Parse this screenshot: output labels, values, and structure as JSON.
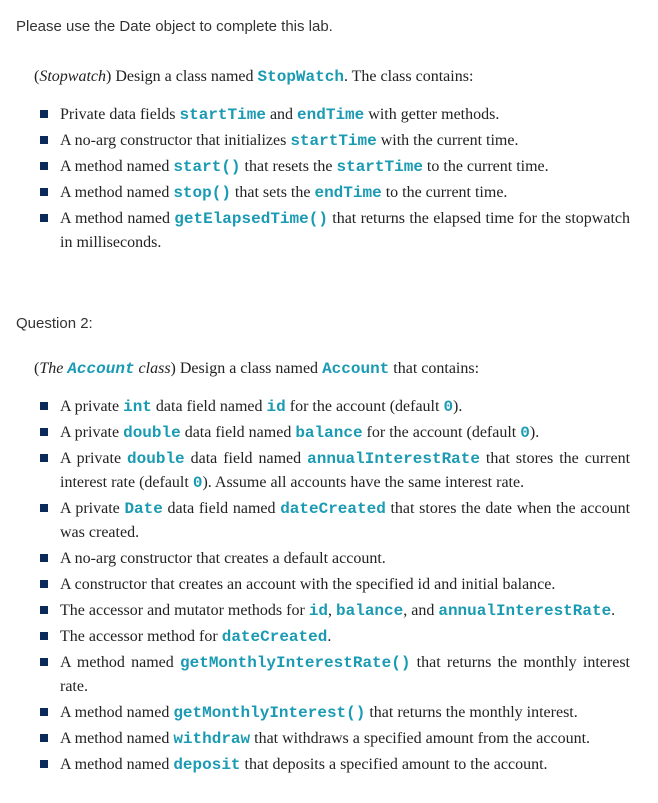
{
  "intro": "Please use the Date object to complete this lab.",
  "q1": {
    "prompt_pre_italic": "(",
    "prompt_italic": "Stopwatch",
    "prompt_post": ") Design a class named ",
    "prompt_code": "StopWatch",
    "prompt_tail": ". The class contains:",
    "items": [
      {
        "segments": [
          {
            "t": "Private data fields "
          },
          {
            "t": "startTime",
            "code": true
          },
          {
            "t": " and "
          },
          {
            "t": "endTime",
            "code": true
          },
          {
            "t": " with getter methods."
          }
        ]
      },
      {
        "segments": [
          {
            "t": "A no-arg constructor that initializes "
          },
          {
            "t": "startTime",
            "code": true
          },
          {
            "t": " with the current time."
          }
        ]
      },
      {
        "segments": [
          {
            "t": "A method named "
          },
          {
            "t": "start()",
            "code": true
          },
          {
            "t": " that resets the "
          },
          {
            "t": "startTime",
            "code": true
          },
          {
            "t": " to the current time."
          }
        ]
      },
      {
        "segments": [
          {
            "t": "A method named "
          },
          {
            "t": "stop()",
            "code": true
          },
          {
            "t": " that sets the "
          },
          {
            "t": "endTime",
            "code": true
          },
          {
            "t": " to the current time."
          }
        ]
      },
      {
        "segments": [
          {
            "t": "A method named "
          },
          {
            "t": "getElapsedTime()",
            "code": true
          },
          {
            "t": " that returns the elapsed time for the stopwatch in milliseconds."
          }
        ]
      }
    ]
  },
  "q2": {
    "heading": "Question 2:",
    "prompt_pre": "(",
    "prompt_italic_pre": "The ",
    "prompt_italic_code": "Account",
    "prompt_italic_post": " class",
    "prompt_post": ") Design a class named ",
    "prompt_code": "Account",
    "prompt_tail": " that contains:",
    "items": [
      {
        "segments": [
          {
            "t": "A private "
          },
          {
            "t": "int",
            "code": true
          },
          {
            "t": " data field named "
          },
          {
            "t": "id",
            "code": true
          },
          {
            "t": " for the account (default "
          },
          {
            "t": "0",
            "code": true
          },
          {
            "t": ")."
          }
        ]
      },
      {
        "segments": [
          {
            "t": "A private "
          },
          {
            "t": "double",
            "code": true
          },
          {
            "t": " data field named "
          },
          {
            "t": "balance",
            "code": true
          },
          {
            "t": " for the account (default "
          },
          {
            "t": "0",
            "code": true
          },
          {
            "t": ")."
          }
        ]
      },
      {
        "segments": [
          {
            "t": "A private "
          },
          {
            "t": "double",
            "code": true
          },
          {
            "t": " data field named "
          },
          {
            "t": "annualInterestRate",
            "code": true
          },
          {
            "t": " that stores the current interest rate (default "
          },
          {
            "t": "0",
            "code": true
          },
          {
            "t": "). Assume all accounts have the same interest rate."
          }
        ]
      },
      {
        "segments": [
          {
            "t": "A private "
          },
          {
            "t": "Date",
            "code": true
          },
          {
            "t": " data field named "
          },
          {
            "t": "dateCreated",
            "code": true
          },
          {
            "t": " that stores the date when the account was created."
          }
        ]
      },
      {
        "segments": [
          {
            "t": "A no-arg constructor that creates a default account."
          }
        ]
      },
      {
        "segments": [
          {
            "t": "A constructor that creates an account with the specified id and initial balance."
          }
        ]
      },
      {
        "segments": [
          {
            "t": "The accessor and mutator methods for "
          },
          {
            "t": "id",
            "code": true
          },
          {
            "t": ", "
          },
          {
            "t": "balance",
            "code": true
          },
          {
            "t": ", and "
          },
          {
            "t": "annualInterestRate",
            "code": true
          },
          {
            "t": "."
          }
        ]
      },
      {
        "segments": [
          {
            "t": "The accessor method for "
          },
          {
            "t": "dateCreated",
            "code": true
          },
          {
            "t": "."
          }
        ]
      },
      {
        "segments": [
          {
            "t": "A method named "
          },
          {
            "t": "getMonthlyInterestRate()",
            "code": true
          },
          {
            "t": " that returns the monthly interest rate."
          }
        ]
      },
      {
        "segments": [
          {
            "t": "A method named "
          },
          {
            "t": "getMonthlyInterest()",
            "code": true
          },
          {
            "t": " that returns the monthly interest."
          }
        ]
      },
      {
        "segments": [
          {
            "t": "A method named "
          },
          {
            "t": "withdraw",
            "code": true
          },
          {
            "t": " that withdraws a specified amount from the account."
          }
        ]
      },
      {
        "segments": [
          {
            "t": "A method named "
          },
          {
            "t": "deposit",
            "code": true
          },
          {
            "t": " that deposits a specified amount to the account."
          }
        ]
      }
    ]
  }
}
